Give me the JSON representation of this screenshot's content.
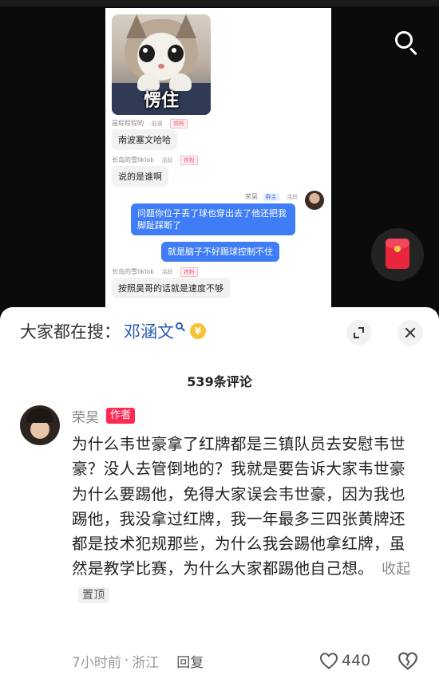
{
  "video": {
    "sticker_caption": "愣住",
    "chat": [
      {
        "kind": "meta",
        "name": "是程程程哟",
        "status": "低调",
        "badge": "铁粉"
      },
      {
        "kind": "left",
        "text": "南波塞文哈哈"
      },
      {
        "kind": "meta",
        "name": "长岛的雪llklok",
        "status": "活跃",
        "badge": "铁粉"
      },
      {
        "kind": "left",
        "text": "说的是谁啊"
      },
      {
        "kind": "meta-right",
        "name": "荣昊",
        "badge": "群主",
        "status": "活跃"
      },
      {
        "kind": "right",
        "text": "问题你位子丢了球也穿出去了他还把我脚趾踩断了"
      },
      {
        "kind": "right",
        "text": "就是脑子不好踢球控制不住"
      },
      {
        "kind": "meta",
        "name": "长岛的雪llklok",
        "status": "活跃",
        "badge": "铁粉"
      },
      {
        "kind": "left",
        "text": "按照昊哥的话就是速度不够"
      }
    ],
    "icons": {
      "search": "search-icon",
      "red_packet": "red-packet-icon"
    }
  },
  "sheet": {
    "search_prefix": "大家都在搜：",
    "search_keyword": "邓涵文",
    "coin_symbol": "¥",
    "comment_count": "539条评论",
    "comment": {
      "username": "荣昊",
      "author_badge": "作者",
      "text": "为什么韦世豪拿了红牌都是三镇队员去安慰韦世豪？没人去管倒地的？我就是要告诉大家韦世豪为什么要踢他，免得大家误会韦世豪，因为我也踢他，我没拿过红牌，我一年最多三四张黄牌还都是技术犯规那些，为什么我会踢他拿红牌，虽然是教学比赛，为什么大家都踢他自己想。",
      "collapse_label": "收起",
      "pin_label": "置顶",
      "time": "7小时前",
      "separator": "·",
      "location": "浙江",
      "reply_label": "回复",
      "like_count": "440"
    }
  },
  "colors": {
    "accent_red": "#fe2c55",
    "link_blue": "#2a5bb5",
    "bubble_blue": "#3f7df6"
  }
}
